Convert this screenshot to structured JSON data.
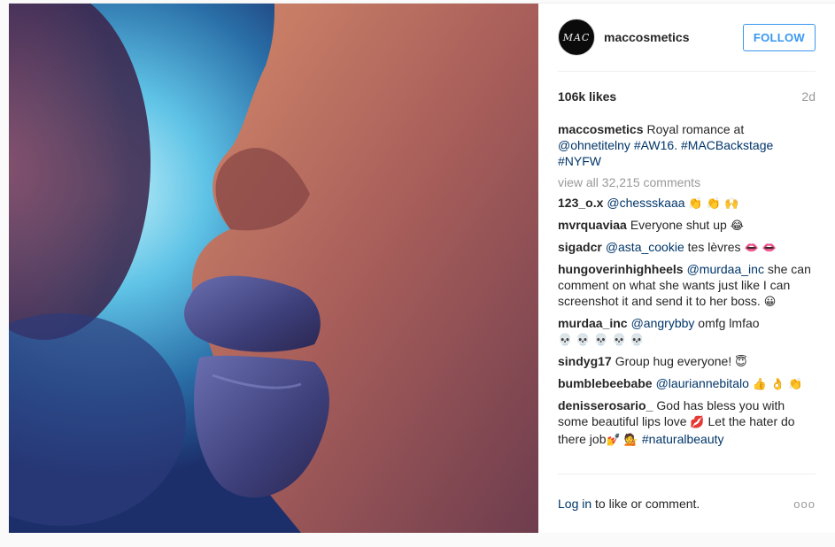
{
  "header": {
    "avatar_text": "MAC",
    "username": "maccosmetics",
    "follow_label": "FOLLOW"
  },
  "stats": {
    "likes": "106k likes",
    "age": "2d"
  },
  "caption": {
    "user": "maccosmetics",
    "text_1": "Royal romance at",
    "mention": "@ohnetitelny",
    "tag_1": "#AW16.",
    "tag_2": "#MACBackstage",
    "tag_3": "#NYFW"
  },
  "view_all": "view all 32,215 comments",
  "comments": [
    {
      "user": "123_o.x",
      "link": "@chessskaaa",
      "text": "",
      "emoji": "👏 👏 🙌"
    },
    {
      "user": "mvrquaviaa",
      "link": "",
      "text": "Everyone shut up",
      "emoji": "😂"
    },
    {
      "user": "sigadcr",
      "link": "@asta_cookie",
      "text": "tes lèvres",
      "emoji": "👄 👄"
    },
    {
      "user": "hungoverinhighheels",
      "link": "@murdaa_inc",
      "text": "she can comment on what she wants just like I can screenshot it and send it to her boss.",
      "emoji": "😀"
    },
    {
      "user": "murdaa_inc",
      "link": "@angrybby",
      "text": "omfg lmfao",
      "emoji": "💀 💀 💀 💀 💀"
    },
    {
      "user": "sindyg17",
      "link": "",
      "text": "Group hug everyone!",
      "emoji": "😇"
    },
    {
      "user": "bumblebeebabe",
      "link": "@lauriannebitalo",
      "text": "",
      "emoji": "👍 👌 👏"
    },
    {
      "user": "denisserosario_",
      "link": "",
      "text": "God has bless you with some beautiful lips love",
      "emoji": "💋",
      "text_2": "Let the hater do there job",
      "emoji_2": "💅 💁",
      "tag": "#naturalbeauty"
    }
  ],
  "footer": {
    "login_link": "Log in",
    "login_rest": "to like or comment.",
    "more": "ooo"
  }
}
